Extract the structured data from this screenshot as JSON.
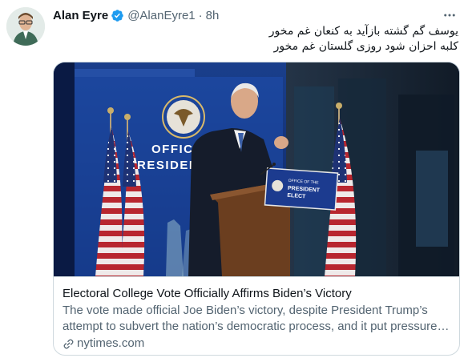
{
  "tweet": {
    "author_name": "Alan Eyre",
    "handle": "@AlanEyre1",
    "separator": "·",
    "time": "8h",
    "text_lines": [
      "یوسف گم گشته بازآید به کنعان غم مخور",
      "کلبه احزان شود روزی گلستان غم مخور"
    ]
  },
  "card": {
    "image_banner_text": [
      "OFFICE",
      "RESIDENT"
    ],
    "podium_sign": [
      "OFFICE OF THE",
      "PRESIDENT",
      "ELECT"
    ],
    "title": "Electoral College Vote Officially Affirms Biden’s Victory",
    "description": "The vote made official Joe Biden’s victory, despite President Trump’s attempt to subvert the nation’s democratic process, and it put pressure on Republicans in Congress to accept the result.",
    "domain": "nytimes.com"
  },
  "colors": {
    "verified": "#1d9bf0",
    "secondary_text": "#536471",
    "border": "#cfd9de"
  },
  "icons": {
    "verified": "verified-badge-icon",
    "more": "more-icon",
    "link": "link-icon"
  }
}
